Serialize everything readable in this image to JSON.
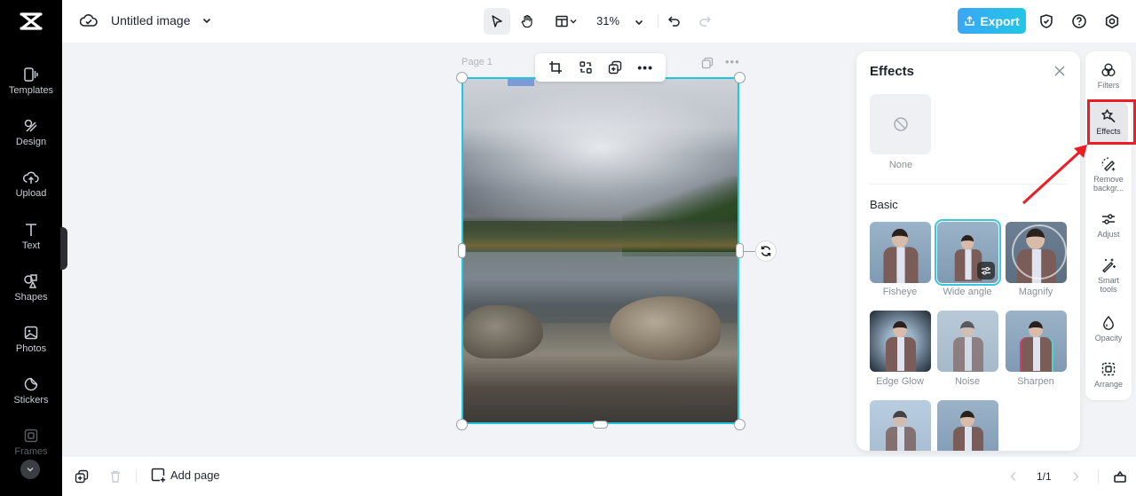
{
  "app": {
    "brand": "CapCut"
  },
  "topbar": {
    "document_title": "Untitled image",
    "zoom_level": "31%",
    "export_label": "Export",
    "tools": [
      "select",
      "hand",
      "layout",
      "undo",
      "redo"
    ]
  },
  "sidebar": {
    "items": [
      {
        "label": "Templates",
        "icon": "templates-icon"
      },
      {
        "label": "Design",
        "icon": "design-icon"
      },
      {
        "label": "Upload",
        "icon": "upload-icon"
      },
      {
        "label": "Text",
        "icon": "text-icon"
      },
      {
        "label": "Shapes",
        "icon": "shapes-icon"
      },
      {
        "label": "Photos",
        "icon": "photos-icon"
      },
      {
        "label": "Stickers",
        "icon": "stickers-icon"
      },
      {
        "label": "Frames",
        "icon": "frames-icon"
      }
    ]
  },
  "canvas": {
    "page_label": "Page 1",
    "float_toolbar": [
      "crop",
      "replace",
      "duplicate",
      "more"
    ]
  },
  "effects_panel": {
    "title": "Effects",
    "none_label": "None",
    "section_basic": "Basic",
    "effects": [
      {
        "label": "Fisheye",
        "selected": false
      },
      {
        "label": "Wide angle",
        "selected": true
      },
      {
        "label": "Magnify",
        "selected": false
      },
      {
        "label": "Edge Glow",
        "selected": false
      },
      {
        "label": "Noise",
        "selected": false
      },
      {
        "label": "Sharpen",
        "selected": false
      }
    ]
  },
  "right_rail": {
    "items": [
      {
        "label": "Filters",
        "icon": "filters-icon"
      },
      {
        "label": "Effects",
        "icon": "effects-icon",
        "active": true
      },
      {
        "label": "Remove backgr...",
        "icon": "remove-background-icon"
      },
      {
        "label": "Adjust",
        "icon": "adjust-icon"
      },
      {
        "label": "Smart tools",
        "icon": "smart-tools-icon"
      },
      {
        "label": "Opacity",
        "icon": "opacity-icon"
      },
      {
        "label": "Arrange",
        "icon": "arrange-icon"
      }
    ]
  },
  "bottombar": {
    "add_page_label": "Add page",
    "page_indicator": "1/1"
  },
  "annotation": {
    "highlight_color": "#ee1c24",
    "target": "Effects"
  },
  "colors": {
    "accent": "#1fc6dd",
    "export_gradient_start": "#3aa6f5",
    "export_gradient_end": "#22c6e6"
  }
}
